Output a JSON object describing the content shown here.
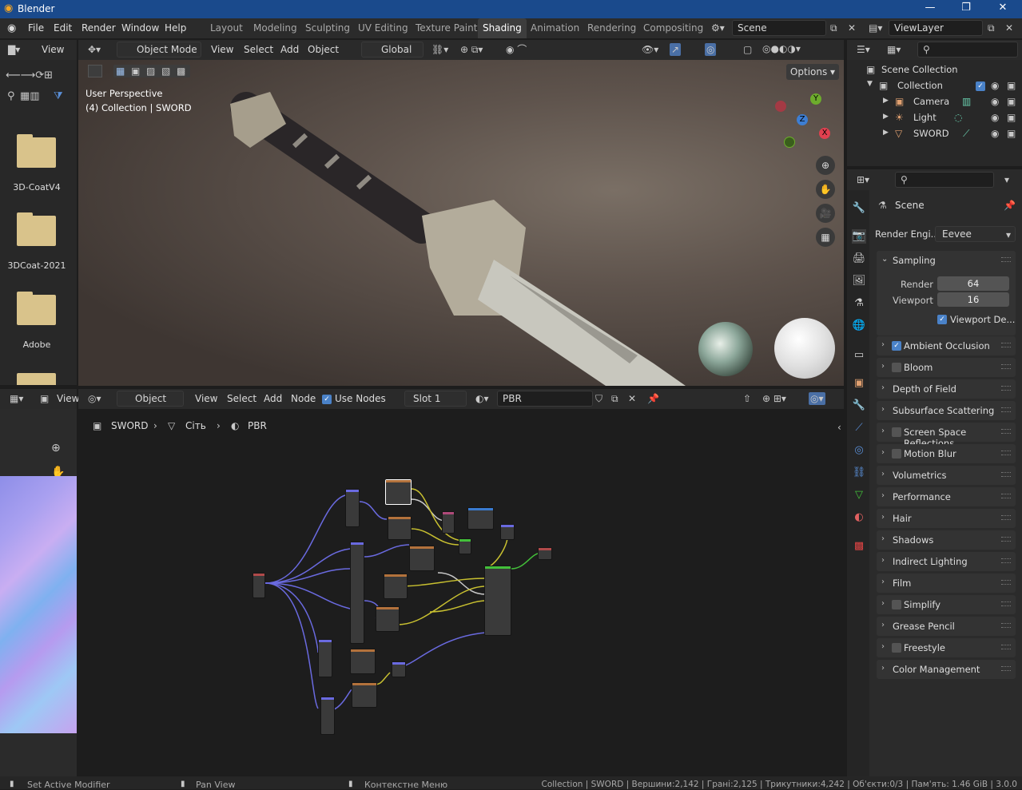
{
  "app": {
    "title": "Blender"
  },
  "menu": {
    "items": [
      "File",
      "Edit",
      "Render",
      "Window",
      "Help"
    ]
  },
  "workspaces": {
    "tabs": [
      "Layout",
      "Modeling",
      "Sculpting",
      "UV Editing",
      "Texture Paint",
      "Shading",
      "Animation",
      "Rendering",
      "Compositing"
    ],
    "active": "Shading"
  },
  "scene_field": "Scene",
  "viewlayer_field": "ViewLayer",
  "filebrowser": {
    "view_label": "View",
    "folders": [
      "3D-CoatV4",
      "3DCoat-2021",
      "Adobe"
    ]
  },
  "viewport": {
    "mode": "Object Mode",
    "menus": [
      "View",
      "Select",
      "Add",
      "Object"
    ],
    "transform_orientation": "Global",
    "options_label": "Options",
    "overlay_line1": "User Perspective",
    "overlay_line2": "(4) Collection | SWORD",
    "gizmo": {
      "y": "Y",
      "z": "Z",
      "x": "X"
    }
  },
  "node_editor": {
    "editor_type": "Object",
    "menus": [
      "View",
      "Select",
      "Add",
      "Node"
    ],
    "use_nodes_label": "Use Nodes",
    "slot": "Slot 1",
    "material": "PBR",
    "breadcrumb": [
      "SWORD",
      "Сіть",
      "PBR"
    ]
  },
  "image_editor": {
    "view_label": "View"
  },
  "outliner": {
    "root": "Scene Collection",
    "collection": "Collection",
    "items": [
      "Camera",
      "Light",
      "SWORD"
    ]
  },
  "properties": {
    "scene_label": "Scene",
    "render_engine_label": "Render Engi...",
    "render_engine_value": "Eevee",
    "sampling": {
      "title": "Sampling",
      "render_label": "Render",
      "render_value": "64",
      "viewport_label": "Viewport",
      "viewport_value": "16",
      "denoise_label": "Viewport De..."
    },
    "sections": [
      {
        "label": "Ambient Occlusion",
        "checkbox": true,
        "checked": true
      },
      {
        "label": "Bloom",
        "checkbox": true,
        "checked": false
      },
      {
        "label": "Depth of Field",
        "checkbox": false
      },
      {
        "label": "Subsurface Scattering",
        "checkbox": false
      },
      {
        "label": "Screen Space Reflections",
        "checkbox": true,
        "checked": false
      },
      {
        "label": "Motion Blur",
        "checkbox": true,
        "checked": false
      },
      {
        "label": "Volumetrics",
        "checkbox": false
      },
      {
        "label": "Performance",
        "checkbox": false
      },
      {
        "label": "Hair",
        "checkbox": false
      },
      {
        "label": "Shadows",
        "checkbox": false
      },
      {
        "label": "Indirect Lighting",
        "checkbox": false
      },
      {
        "label": "Film",
        "checkbox": false
      },
      {
        "label": "Simplify",
        "checkbox": true,
        "checked": false
      },
      {
        "label": "Grease Pencil",
        "checkbox": false
      },
      {
        "label": "Freestyle",
        "checkbox": true,
        "checked": false
      },
      {
        "label": "Color Management",
        "checkbox": false
      }
    ]
  },
  "status": {
    "left1": "Set Active Modifier",
    "left2": "Pan View",
    "left3": "Контекстне Меню",
    "right": "Collection | SWORD | Вершини:2,142 | Грані:2,125 | Трикутники:4,242 | Об'єкти:0/3 | Пам'ять: 1.46 GiB | 3.0.0"
  },
  "colors": {
    "titlebar": "#1a4a8c",
    "accent": "#4a82c8",
    "header": "#2a2a2a",
    "panel": "#303030"
  }
}
